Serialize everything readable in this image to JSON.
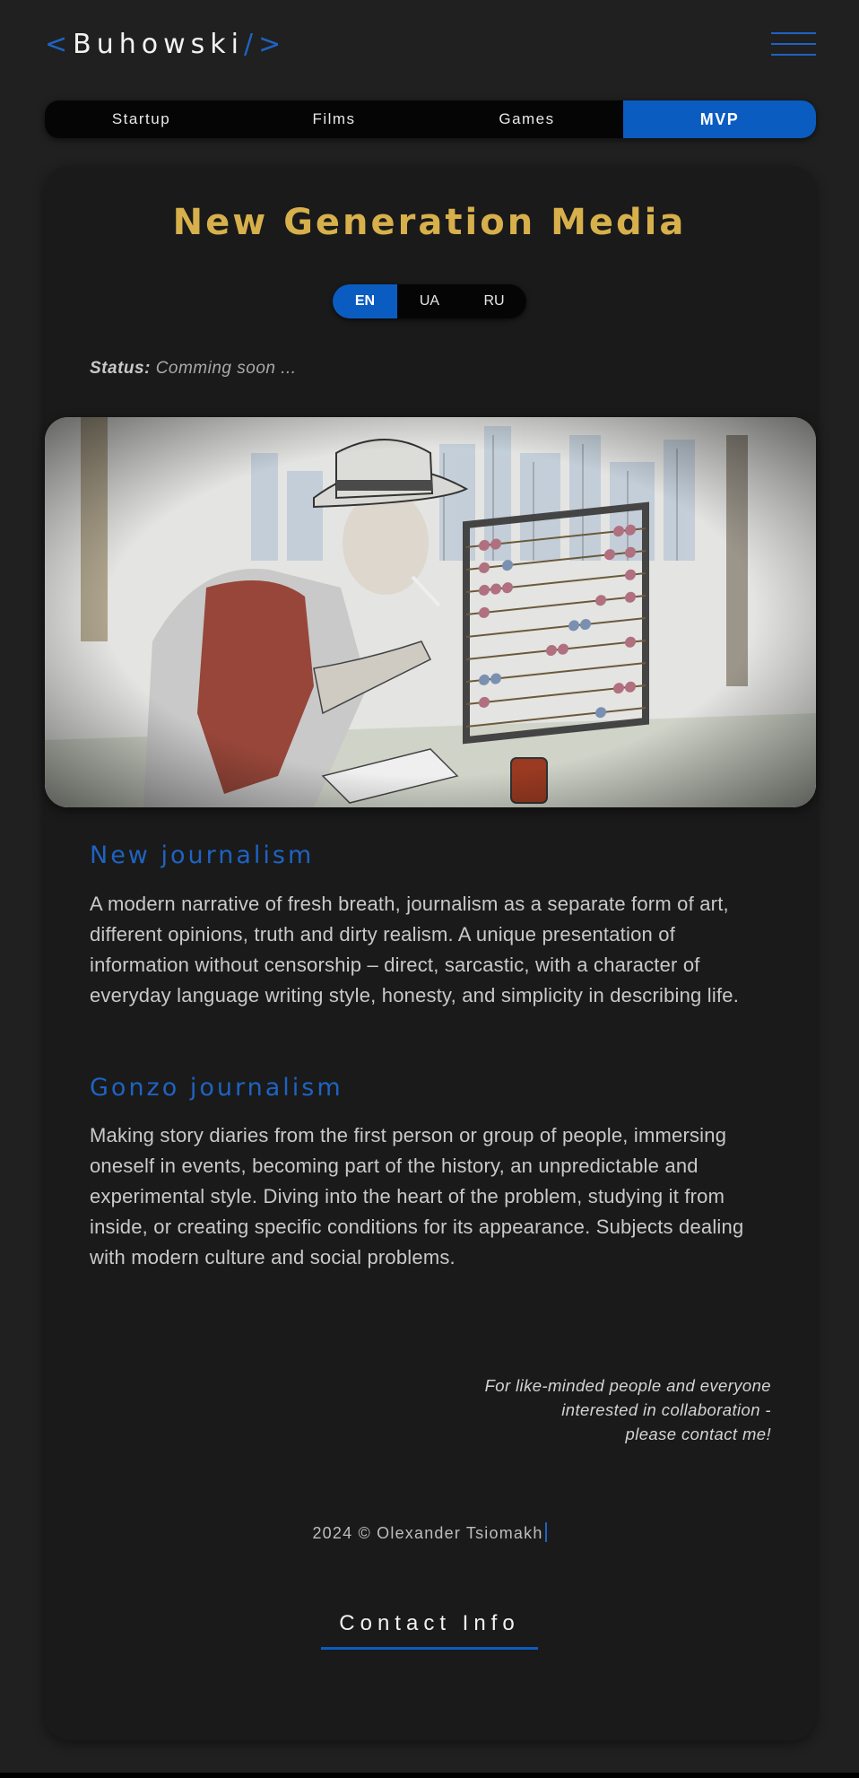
{
  "header": {
    "logo_open": "<",
    "logo_text": "Buhowski",
    "logo_close": "/>"
  },
  "tabs": [
    {
      "label": "Startup",
      "active": false
    },
    {
      "label": "Films",
      "active": false
    },
    {
      "label": "Games",
      "active": false
    },
    {
      "label": "MVP",
      "active": true
    }
  ],
  "main": {
    "title": "New Generation Media",
    "languages": [
      {
        "label": "EN",
        "active": true
      },
      {
        "label": "UA",
        "active": false
      },
      {
        "label": "RU",
        "active": false
      }
    ],
    "status_label": "Status:",
    "status_value": "Comming soon ...",
    "sections": [
      {
        "heading": "New journalism",
        "text": "A modern narrative of fresh breath, journalism as a separate form of art, different opinions, truth and dirty realism. A unique presentation of information without censorship – direct, sarcastic, with a character of everyday language writing style, honesty, and simplicity in describing life."
      },
      {
        "heading": "Gonzo journalism",
        "text": "Making story diaries from the first person or group of people, immersing oneself in events, becoming part of the history, an unpredictable and experimental style. Diving into the heart of the problem, studying it from inside, or creating specific conditions for its appearance. Subjects dealing with modern culture and social problems."
      }
    ],
    "note_lines": [
      "For like-minded people and everyone",
      "interested in collaboration -",
      "please contact me!"
    ],
    "copyright": "2024 © Olexander Tsiomakh",
    "contact_label": "Contact Info"
  },
  "colors": {
    "accent": "#0b5cc1",
    "title": "#d7b04c",
    "background": "#202020",
    "card": "#1a1a1a"
  }
}
